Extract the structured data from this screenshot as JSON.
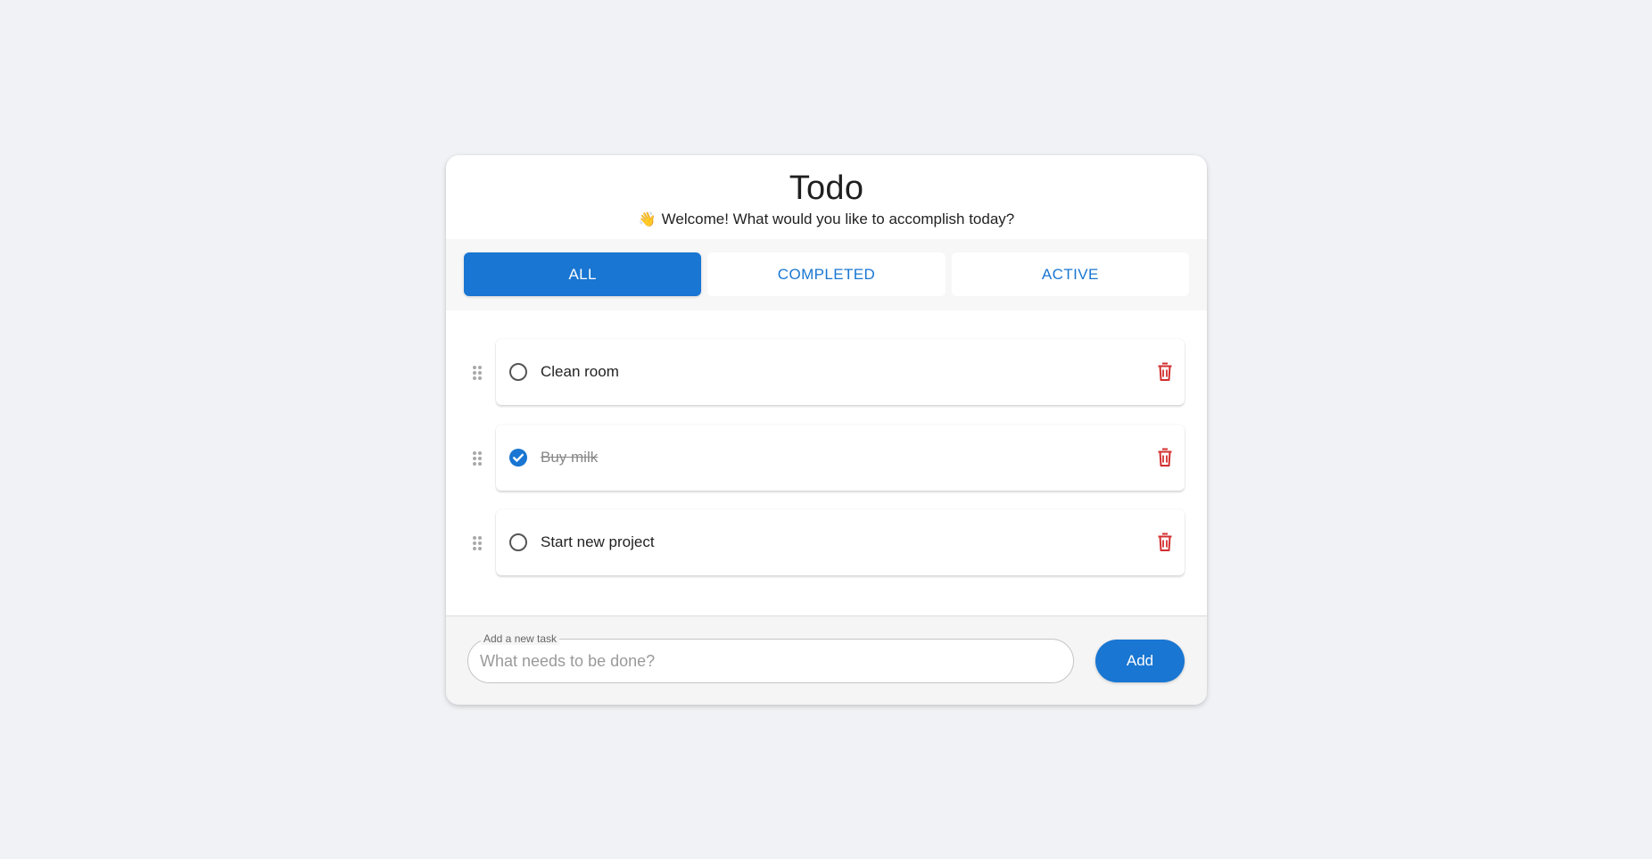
{
  "app": {
    "title": "Todo",
    "subtitle_emoji": "👋",
    "subtitle": "Welcome! What would you like to accomplish today?"
  },
  "tabs": [
    {
      "label": "ALL",
      "active": true
    },
    {
      "label": "COMPLETED",
      "active": false
    },
    {
      "label": "ACTIVE",
      "active": false
    }
  ],
  "todos": [
    {
      "text": "Clean room",
      "completed": false
    },
    {
      "text": "Buy milk",
      "completed": true
    },
    {
      "text": "Start new project",
      "completed": false
    }
  ],
  "new_task": {
    "legend": "Add a new task",
    "placeholder": "What needs to be done?",
    "value": ""
  },
  "add_button": {
    "label": "Add"
  },
  "icons": {
    "check": "checkmark-icon",
    "delete": "trash-icon",
    "drag": "drag-handle-icon",
    "wave": "waving-hand-emoji"
  },
  "colors": {
    "accent": "#1976d2",
    "delete": "#d32f2f",
    "background": "#f0f2f5"
  }
}
